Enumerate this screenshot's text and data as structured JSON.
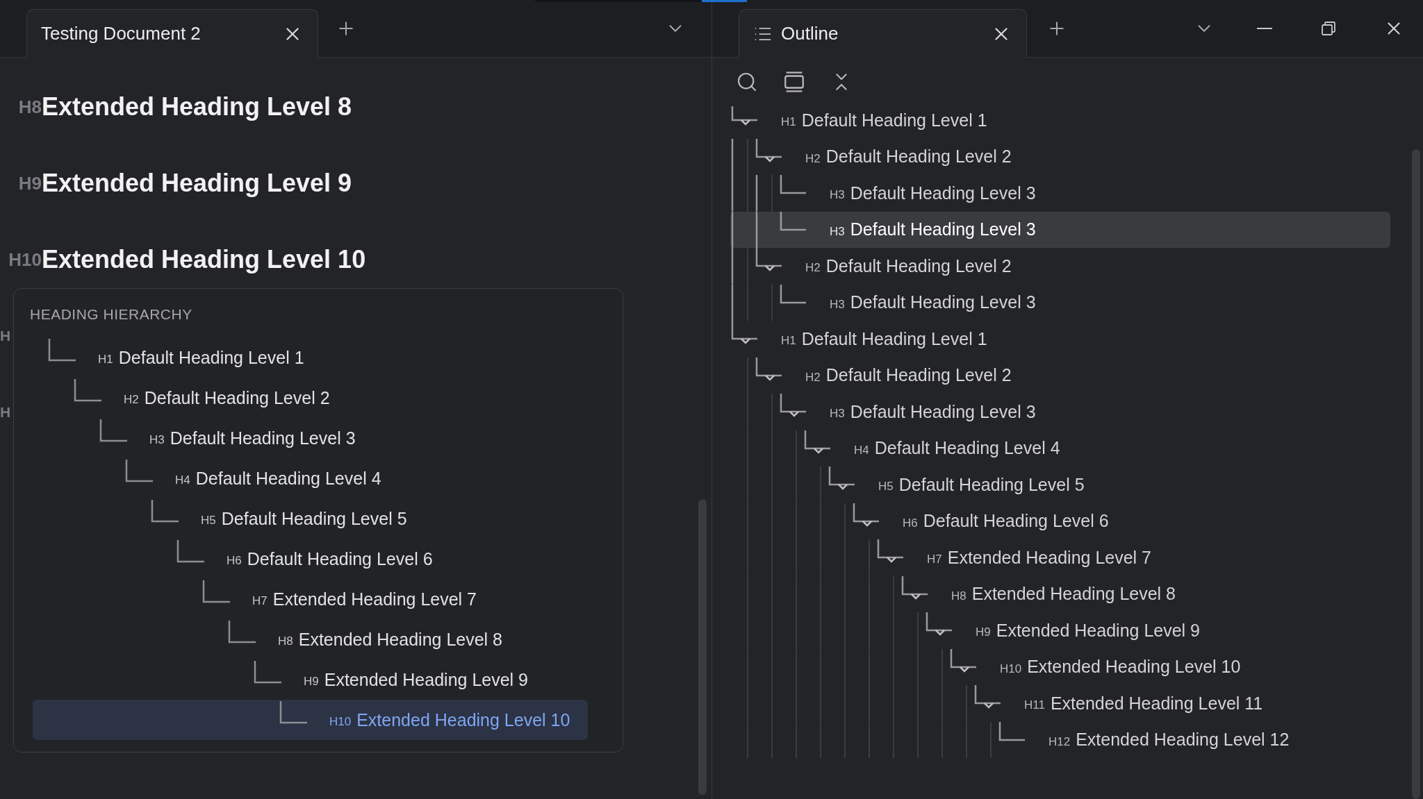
{
  "left_tab": {
    "title": "Testing Document 2",
    "selected": true
  },
  "left_headings": [
    {
      "prefix": "H8",
      "text": "Extended Heading Level 8"
    },
    {
      "prefix": "H9",
      "text": "Extended Heading Level 9"
    },
    {
      "prefix": "H10",
      "text": "Extended Heading Level 10"
    },
    {
      "prefix": "H"
    },
    {
      "prefix": "H"
    }
  ],
  "hierarchy_panel": {
    "title": "HEADING HIERARCHY",
    "items": [
      {
        "prefix": "H1",
        "text": "Default Heading Level 1",
        "selected": false,
        "children": [
          {
            "prefix": "H2",
            "text": "Default Heading Level 2",
            "selected": false,
            "children": [
              {
                "prefix": "H3",
                "text": "Default Heading Level 3",
                "selected": false,
                "children": [
                  {
                    "prefix": "H4",
                    "text": "Default Heading Level 4",
                    "selected": false,
                    "children": [
                      {
                        "prefix": "H5",
                        "text": "Default Heading Level 5",
                        "selected": false,
                        "children": [
                          {
                            "prefix": "H6",
                            "text": "Default Heading Level 6",
                            "selected": false,
                            "children": [
                              {
                                "prefix": "H7",
                                "text": "Extended Heading Level 7",
                                "selected": false,
                                "children": [
                                  {
                                    "prefix": "H8",
                                    "text": "Extended Heading Level 8",
                                    "selected": false,
                                    "children": [
                                      {
                                        "prefix": "H9",
                                        "text": "Extended Heading Level 9",
                                        "selected": false,
                                        "children": [
                                          {
                                            "prefix": "H10",
                                            "text": "Extended Heading Level 10",
                                            "selected": true
                                          }
                                        ]
                                      }
                                    ]
                                  }
                                ]
                              }
                            ]
                          }
                        ]
                      }
                    ]
                  }
                ]
              }
            ]
          }
        ]
      }
    ]
  },
  "outline_tab": {
    "title": "Outline",
    "selected": true
  },
  "outline": {
    "items": [
      {
        "prefix": "H1",
        "text": "Default Heading Level 1",
        "selected": false,
        "expanded": true,
        "children": [
          {
            "prefix": "H2",
            "text": "Default Heading Level 2",
            "selected": false,
            "expanded": true,
            "children": [
              {
                "prefix": "H3",
                "text": "Default Heading Level 3",
                "selected": false
              },
              {
                "prefix": "H3",
                "text": "Default Heading Level 3",
                "selected": true
              }
            ]
          },
          {
            "prefix": "H2",
            "text": "Default Heading Level 2",
            "selected": false,
            "expanded": true,
            "children": [
              {
                "prefix": "H3",
                "text": "Default Heading Level 3",
                "selected": false
              }
            ]
          }
        ]
      },
      {
        "prefix": "H1",
        "text": "Default Heading Level 1",
        "selected": false,
        "expanded": true,
        "children": [
          {
            "prefix": "H2",
            "text": "Default Heading Level 2",
            "selected": false,
            "expanded": true,
            "children": [
              {
                "prefix": "H3",
                "text": "Default Heading Level 3",
                "selected": false,
                "expanded": true,
                "children": [
                  {
                    "prefix": "H4",
                    "text": "Default Heading Level 4",
                    "selected": false,
                    "expanded": true,
                    "children": [
                      {
                        "prefix": "H5",
                        "text": "Default Heading Level 5",
                        "selected": false,
                        "expanded": true,
                        "children": [
                          {
                            "prefix": "H6",
                            "text": "Default Heading Level 6",
                            "selected": false,
                            "expanded": true,
                            "children": [
                              {
                                "prefix": "H7",
                                "text": "Extended Heading Level 7",
                                "selected": false,
                                "expanded": true,
                                "children": [
                                  {
                                    "prefix": "H8",
                                    "text": "Extended Heading Level 8",
                                    "selected": false,
                                    "expanded": true,
                                    "children": [
                                      {
                                        "prefix": "H9",
                                        "text": "Extended Heading Level 9",
                                        "selected": false,
                                        "expanded": true,
                                        "children": [
                                          {
                                            "prefix": "H10",
                                            "text": "Extended Heading Level 10",
                                            "selected": false,
                                            "expanded": true,
                                            "children": [
                                              {
                                                "prefix": "H11",
                                                "text": "Extended Heading Level 11",
                                                "selected": false,
                                                "expanded": true,
                                                "children": [
                                                  {
                                                    "prefix": "H12",
                                                    "text": "Extended Heading Level 12",
                                                    "selected": false
                                                  }
                                                ]
                                              }
                                            ]
                                          }
                                        ]
                                      }
                                    ]
                                  }
                                ]
                              }
                            ]
                          }
                        ]
                      }
                    ]
                  }
                ]
              }
            ]
          }
        ]
      }
    ]
  }
}
